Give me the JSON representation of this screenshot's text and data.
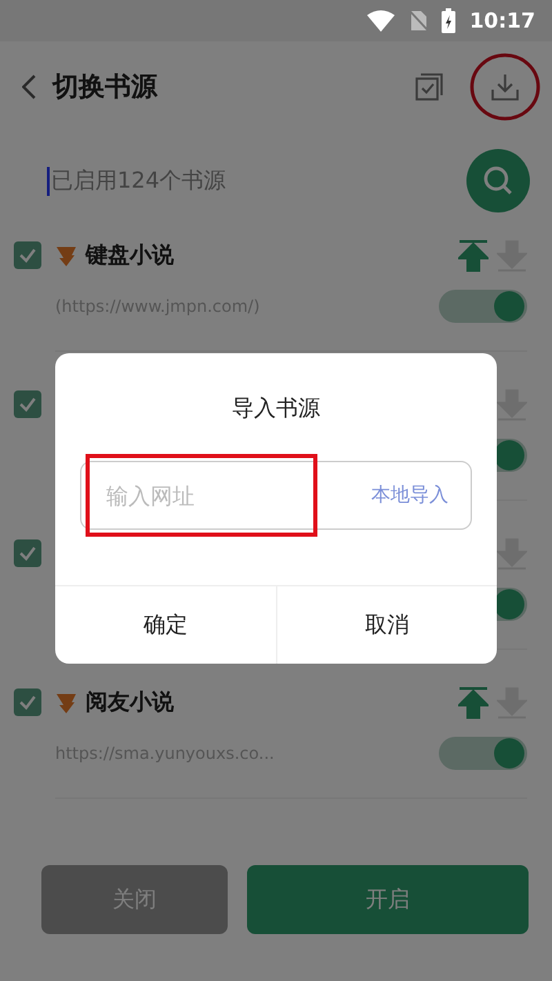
{
  "status_bar": {
    "time": "10:17"
  },
  "header": {
    "title": "切换书源"
  },
  "summary": {
    "text": "已启用124个书源"
  },
  "sources": [
    {
      "checked": true,
      "name": "键盘小说",
      "url": "(https://www.jmpn.com/)",
      "enabled": true
    },
    {
      "checked": true,
      "enabled": true
    },
    {
      "checked": true,
      "enabled": true
    },
    {
      "checked": true,
      "name": "阅友小说",
      "url": "https://sma.yunyouxs.co...",
      "enabled": true
    }
  ],
  "footer_buttons": [
    {
      "label": "关闭",
      "disabled": true
    },
    {
      "label": "开启",
      "disabled": false
    }
  ],
  "dialog": {
    "title": "导入书源",
    "url_field": {
      "placeholder": "输入网址"
    },
    "local_link": "本地导入",
    "buttons": [
      "确定",
      "取消"
    ]
  }
}
